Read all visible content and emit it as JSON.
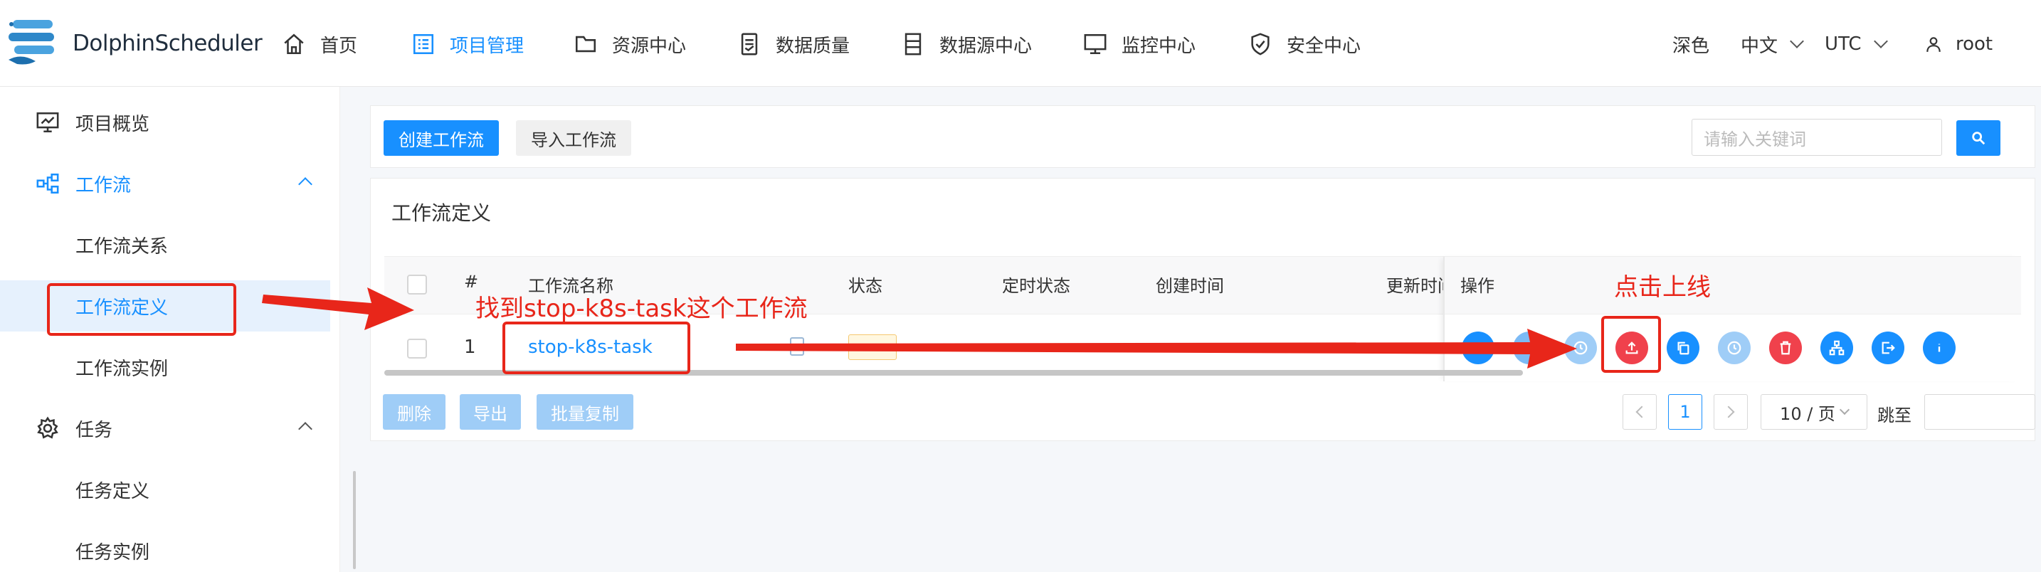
{
  "app": {
    "name": "DolphinScheduler"
  },
  "nav": [
    {
      "label": "首页",
      "icon": "home-icon"
    },
    {
      "label": "项目管理",
      "icon": "project-icon",
      "active": true
    },
    {
      "label": "资源中心",
      "icon": "folder-icon"
    },
    {
      "label": "数据质量",
      "icon": "data-quality-icon"
    },
    {
      "label": "数据源中心",
      "icon": "datasource-icon"
    },
    {
      "label": "监控中心",
      "icon": "monitor-icon"
    },
    {
      "label": "安全中心",
      "icon": "shield-icon"
    }
  ],
  "header_right": {
    "theme": "深色",
    "language": "中文",
    "timezone": "UTC",
    "user": "root"
  },
  "sidebar": {
    "items": [
      {
        "label": "项目概览",
        "icon": "overview-icon"
      },
      {
        "label": "工作流",
        "icon": "workflow-icon",
        "expanded": true
      },
      {
        "label": "工作流关系"
      },
      {
        "label": "工作流定义",
        "selected": true
      },
      {
        "label": "工作流实例"
      },
      {
        "label": "任务",
        "icon": "gear-icon",
        "expanded": true
      },
      {
        "label": "任务定义"
      },
      {
        "label": "任务实例"
      }
    ]
  },
  "toolbar": {
    "create_label": "创建工作流",
    "import_label": "导入工作流",
    "search_placeholder": "请输入关键词"
  },
  "table": {
    "title": "工作流定义",
    "columns": [
      "#",
      "工作流名称",
      "状态",
      "定时状态",
      "创建时间",
      "更新时间",
      "操作"
    ],
    "rows": [
      {
        "index": "1",
        "name": "stop-k8s-task"
      }
    ]
  },
  "bulk_actions": {
    "delete_label": "删除",
    "export_label": "导出",
    "copy_label": "批量复制"
  },
  "pagination": {
    "current_page": "1",
    "page_size": "10 / 页",
    "jump_label": "跳至"
  },
  "annotations": {
    "find_workflow": "找到stop-k8s-task这个工作流",
    "click_online": "点击上线"
  },
  "colors": {
    "primary": "#1890ff",
    "danger": "#f0414c",
    "annotation": "#e8261a"
  }
}
